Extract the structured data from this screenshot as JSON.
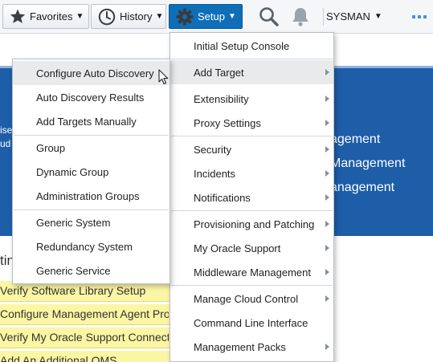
{
  "toolbar": {
    "favorites_label": "Favorites",
    "history_label": "History",
    "setup_label": "Setup",
    "user_label": "SYSMAN",
    "setup_color": "#0e6eb8",
    "icons": [
      "star-icon",
      "clock-icon",
      "gear-icon",
      "search-icon",
      "bell-icon",
      "more-icon"
    ]
  },
  "background": {
    "banner_lines": [
      "agement",
      "Management",
      "anagement"
    ],
    "banner_left": [
      "ise",
      "ud"
    ],
    "section_heading": "tin",
    "tasks": [
      "Verify Software Library Setup",
      "Configure Management Agent Pro",
      "Verify My Oracle Support Connect",
      "Add An Additional OMS"
    ]
  },
  "setup_menu": {
    "items": [
      {
        "label": "Initial Setup Console",
        "submenu": false
      },
      {
        "label": "Add Target",
        "submenu": true
      },
      {
        "label": "Extensibility",
        "submenu": true
      },
      {
        "label": "Proxy Settings",
        "submenu": true
      },
      {
        "label": "Security",
        "submenu": true
      },
      {
        "label": "Incidents",
        "submenu": true
      },
      {
        "label": "Notifications",
        "submenu": true
      },
      {
        "label": "Provisioning and Patching",
        "submenu": true
      },
      {
        "label": "My Oracle Support",
        "submenu": true
      },
      {
        "label": "Middleware Management",
        "submenu": true
      },
      {
        "label": "Manage Cloud Control",
        "submenu": true
      },
      {
        "label": "Command Line Interface",
        "submenu": false
      },
      {
        "label": "Management Packs",
        "submenu": true
      }
    ],
    "highlighted": "Add Target"
  },
  "add_target_menu": {
    "items": [
      {
        "label": "Configure Auto Discovery"
      },
      {
        "label": "Auto Discovery Results"
      },
      {
        "label": "Add Targets Manually"
      },
      {
        "label": "Group"
      },
      {
        "label": "Dynamic Group"
      },
      {
        "label": "Administration Groups"
      },
      {
        "label": "Generic System"
      },
      {
        "label": "Redundancy System"
      },
      {
        "label": "Generic Service"
      }
    ],
    "highlighted": "Configure Auto Discovery"
  }
}
